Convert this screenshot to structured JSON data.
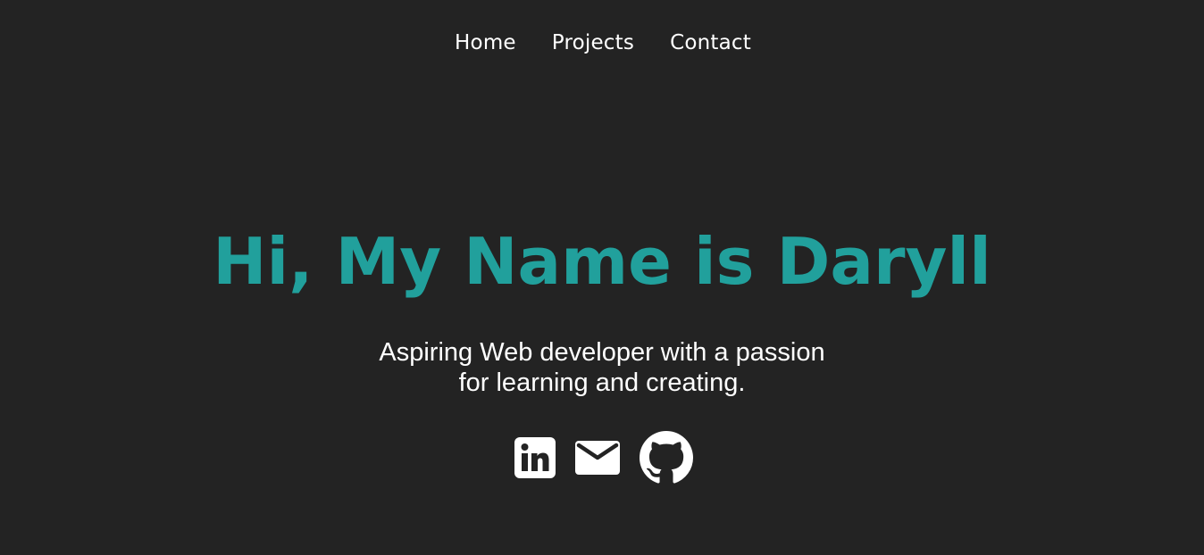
{
  "nav": {
    "items": [
      {
        "label": "Home"
      },
      {
        "label": "Projects"
      },
      {
        "label": "Contact"
      }
    ]
  },
  "hero": {
    "title": "Hi, My Name is Daryll",
    "tagline_line1": "Aspiring Web developer with a passion",
    "tagline_line2": "for learning and creating."
  },
  "socials": [
    {
      "icon": "linkedin-icon"
    },
    {
      "icon": "email-icon"
    },
    {
      "icon": "github-icon"
    }
  ],
  "colors": {
    "background": "#232323",
    "accent": "#21a09c",
    "text": "#ffffff"
  }
}
